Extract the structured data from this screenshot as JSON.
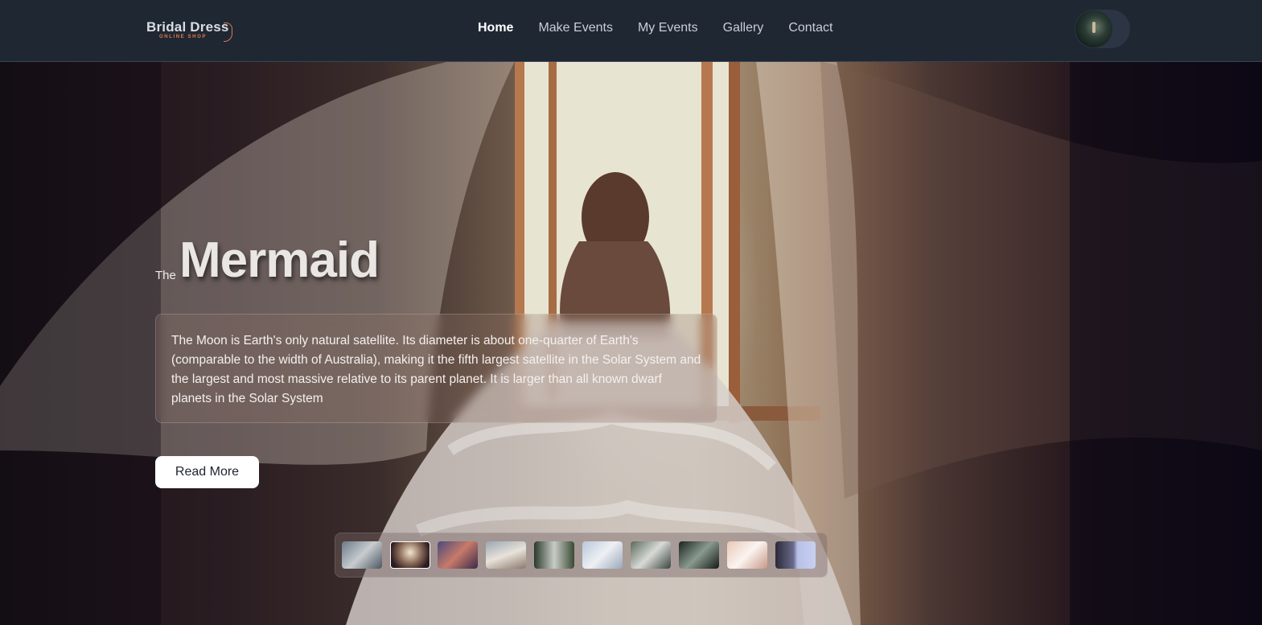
{
  "brand": {
    "name": "Bridal Dress",
    "tagline": "ONLINE SHOP",
    "accent": "#e0784a"
  },
  "nav": {
    "items": [
      {
        "label": "Home",
        "active": true
      },
      {
        "label": "Make Events",
        "active": false
      },
      {
        "label": "My Events",
        "active": false
      },
      {
        "label": "Gallery",
        "active": false
      },
      {
        "label": "Contact",
        "active": false
      }
    ]
  },
  "user": {
    "avatar_icon": "user-avatar"
  },
  "hero": {
    "prefix": "The",
    "title": "Mermaid",
    "description": "The Moon is Earth's only natural satellite. Its diameter is about one-quarter of Earth's (comparable to the width of Australia), making it the fifth largest satellite in the Solar System and the largest and most massive relative to its parent planet. It is larger than all known dwarf planets in the Solar System",
    "cta_label": "Read More"
  },
  "thumbnails": {
    "count": 10,
    "active_index": 1
  },
  "colors": {
    "navbar_bg": "#1f2733",
    "button_bg": "#ffffff",
    "button_text": "#1f2430"
  }
}
